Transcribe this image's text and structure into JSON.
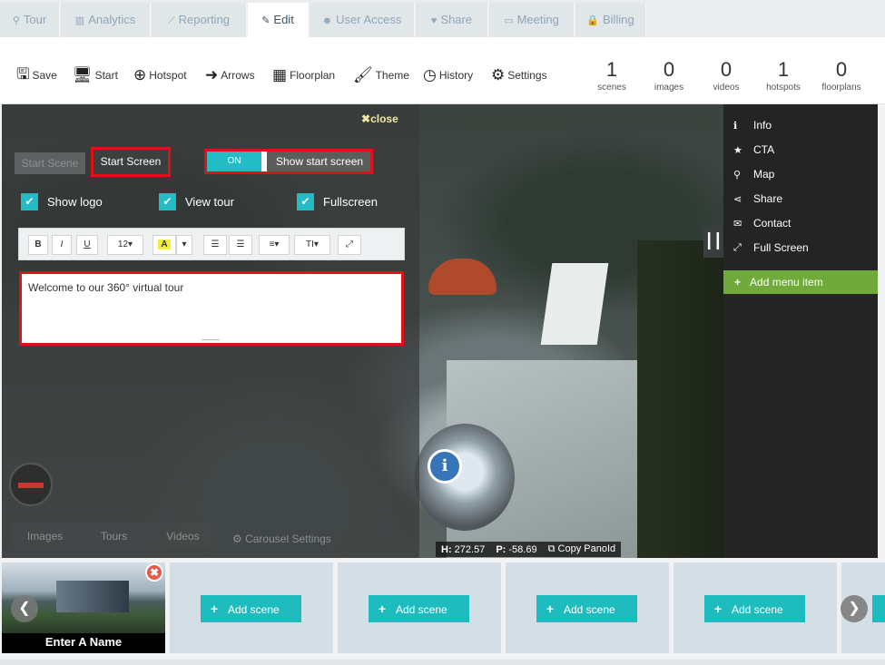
{
  "tabs": [
    {
      "icon": "map-marker-icon",
      "glyph": "⚲",
      "label": "Tour"
    },
    {
      "icon": "bar-chart-icon",
      "glyph": "▥",
      "label": "Analytics"
    },
    {
      "icon": "line-chart-icon",
      "glyph": "⟋",
      "label": "Reporting"
    },
    {
      "icon": "pencil-icon",
      "glyph": "✎",
      "label": "Edit"
    },
    {
      "icon": "users-icon",
      "glyph": "☻",
      "label": "User Access"
    },
    {
      "icon": "heart-icon",
      "glyph": "♥",
      "label": "Share"
    },
    {
      "icon": "monitor-icon",
      "glyph": "▭",
      "label": "Meeting"
    },
    {
      "icon": "lock-icon",
      "glyph": "🔒",
      "label": "Billing"
    }
  ],
  "toolbar": {
    "buttons": [
      {
        "icon": "save-icon",
        "glyph": "🖫",
        "label": "Save"
      },
      {
        "icon": "monitor-icon",
        "glyph": "🖥",
        "label": "Start"
      },
      {
        "icon": "plus-circle-icon",
        "glyph": "⊕",
        "label": "Hotspot"
      },
      {
        "icon": "arrow-circle-icon",
        "glyph": "➜",
        "label": "Arrows"
      },
      {
        "icon": "floorplan-icon",
        "glyph": "▦",
        "label": "Floorplan"
      },
      {
        "icon": "brush-icon",
        "glyph": "🖌",
        "label": "Theme"
      },
      {
        "icon": "history-icon",
        "glyph": "◷",
        "label": "History"
      },
      {
        "icon": "gear-icon",
        "glyph": "⚙",
        "label": "Settings"
      }
    ],
    "stats": [
      {
        "value": "1",
        "label": "scenes"
      },
      {
        "value": "0",
        "label": "images"
      },
      {
        "value": "0",
        "label": "videos"
      },
      {
        "value": "1",
        "label": "hotspots"
      },
      {
        "value": "0",
        "label": "floorplans"
      }
    ]
  },
  "panel": {
    "close_label": "close",
    "start_scene": "Start Scene",
    "start_screen": "Start Screen",
    "toggle_state": "ON",
    "toggle_label": "Show start screen",
    "checks": [
      "Show logo",
      "View tour",
      "Fullscreen"
    ],
    "editor_buttons": {
      "bold": "B",
      "italic": "I",
      "underline": "U",
      "font_size": "12",
      "color": "A"
    },
    "editor_text": "Welcome to our 360° virtual tour",
    "bottom_tabs": [
      "Images",
      "Tours",
      "Videos"
    ],
    "carousel_settings": "Carousel Settings"
  },
  "viewer": {
    "info_glyph": "i",
    "coords": {
      "h_label": "H:",
      "h_value": "272.57",
      "p_label": "P:",
      "p_value": "-58.69",
      "copy_label": "Copy PanoId"
    }
  },
  "right_menu": {
    "items": [
      {
        "icon": "info-icon",
        "glyph": "ℹ",
        "label": "Info"
      },
      {
        "icon": "star-icon",
        "glyph": "★",
        "label": "CTA"
      },
      {
        "icon": "map-pin-icon",
        "glyph": "⚲",
        "label": "Map"
      },
      {
        "icon": "share-icon",
        "glyph": "⋖",
        "label": "Share"
      },
      {
        "icon": "envelope-icon",
        "glyph": "✉",
        "label": "Contact"
      },
      {
        "icon": "expand-icon",
        "glyph": "⤢",
        "label": "Full Screen"
      }
    ],
    "add_item": "Add menu item"
  },
  "scenes": {
    "current_name": "Enter A Name",
    "add_label": "Add scene"
  }
}
